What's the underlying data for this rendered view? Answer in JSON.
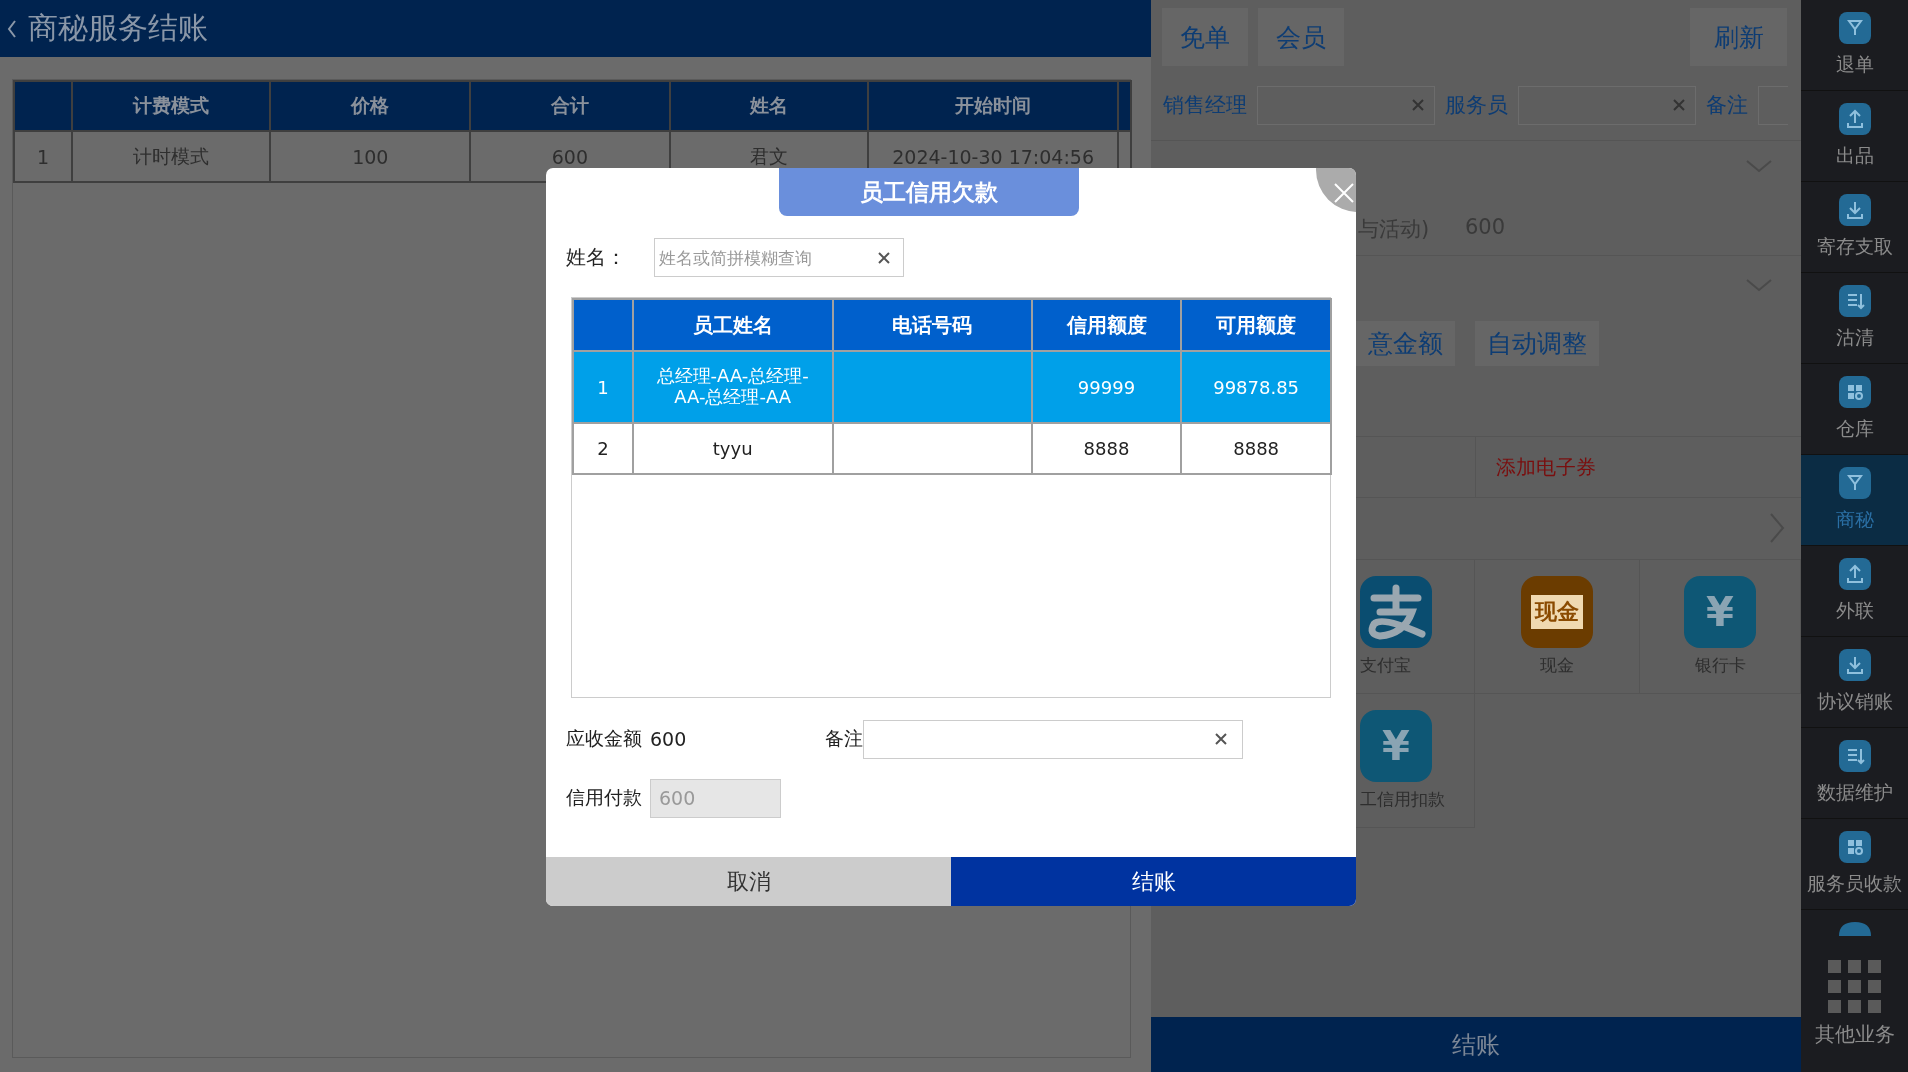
{
  "header": {
    "title": "商秘服务结账"
  },
  "orders": {
    "columns": [
      "计费模式",
      "价格",
      "合计",
      "姓名",
      "开始时间"
    ],
    "rows": [
      {
        "index": "1",
        "cells": [
          "计时模式",
          "100",
          "600",
          "君文",
          "2024-10-30 17:04:56"
        ]
      }
    ]
  },
  "right_panel": {
    "top_buttons": [
      {
        "label": "免单"
      },
      {
        "label": "会员"
      }
    ],
    "refresh": "刷新",
    "filters": [
      {
        "label": "销售经理"
      },
      {
        "label": "服务员"
      }
    ],
    "note_label": "备注",
    "activity": {
      "label": "与活动)",
      "value": "600"
    },
    "adjust_buttons": [
      {
        "label": "意金额"
      },
      {
        "label": "自动调整"
      }
    ],
    "coupon": "添加电子券",
    "payments": [
      {
        "label": "支付宝",
        "kind": "alipay"
      },
      {
        "label": "现金",
        "kind": "cash",
        "icon_text": "现金"
      },
      {
        "label": "银行卡",
        "kind": "yen",
        "icon_text": "¥"
      },
      {
        "label": "工信用扣款",
        "kind": "yen",
        "icon_text": "¥"
      }
    ],
    "checkout": "结账"
  },
  "sidebar": {
    "items": [
      {
        "label": "退单",
        "selected": false
      },
      {
        "label": "出品",
        "selected": false
      },
      {
        "label": "寄存支取",
        "selected": false
      },
      {
        "label": "沽清",
        "selected": false
      },
      {
        "label": "仓库",
        "selected": false
      },
      {
        "label": "商秘",
        "selected": true
      },
      {
        "label": "外联",
        "selected": false
      },
      {
        "label": "协议销账",
        "selected": false
      },
      {
        "label": "数据维护",
        "selected": false
      },
      {
        "label": "服务员收款",
        "selected": false
      }
    ],
    "more": "其他业务"
  },
  "dialog": {
    "title": "员工信用欠款",
    "name_label": "姓名：",
    "search_placeholder": "姓名或简拼模糊查询",
    "columns": [
      "员工姓名",
      "电话号码",
      "信用额度",
      "可用额度"
    ],
    "rows": [
      {
        "index": "1",
        "name": "总经理-AA-总经理-AA-总经理-AA",
        "credit_limit": "99999",
        "available": "99878.85",
        "selected": true
      },
      {
        "index": "2",
        "name": "tyyu",
        "credit_limit": "8888",
        "available": "8888",
        "selected": false
      }
    ],
    "receivable": {
      "label": "应收金额",
      "value": "600"
    },
    "note_label": "备注",
    "credit_payment": {
      "label": "信用付款",
      "value": "600",
      "disabled": true
    },
    "buttons": [
      {
        "label": "取消",
        "kind": "cancel"
      },
      {
        "label": "结账",
        "kind": "confirm"
      }
    ]
  }
}
